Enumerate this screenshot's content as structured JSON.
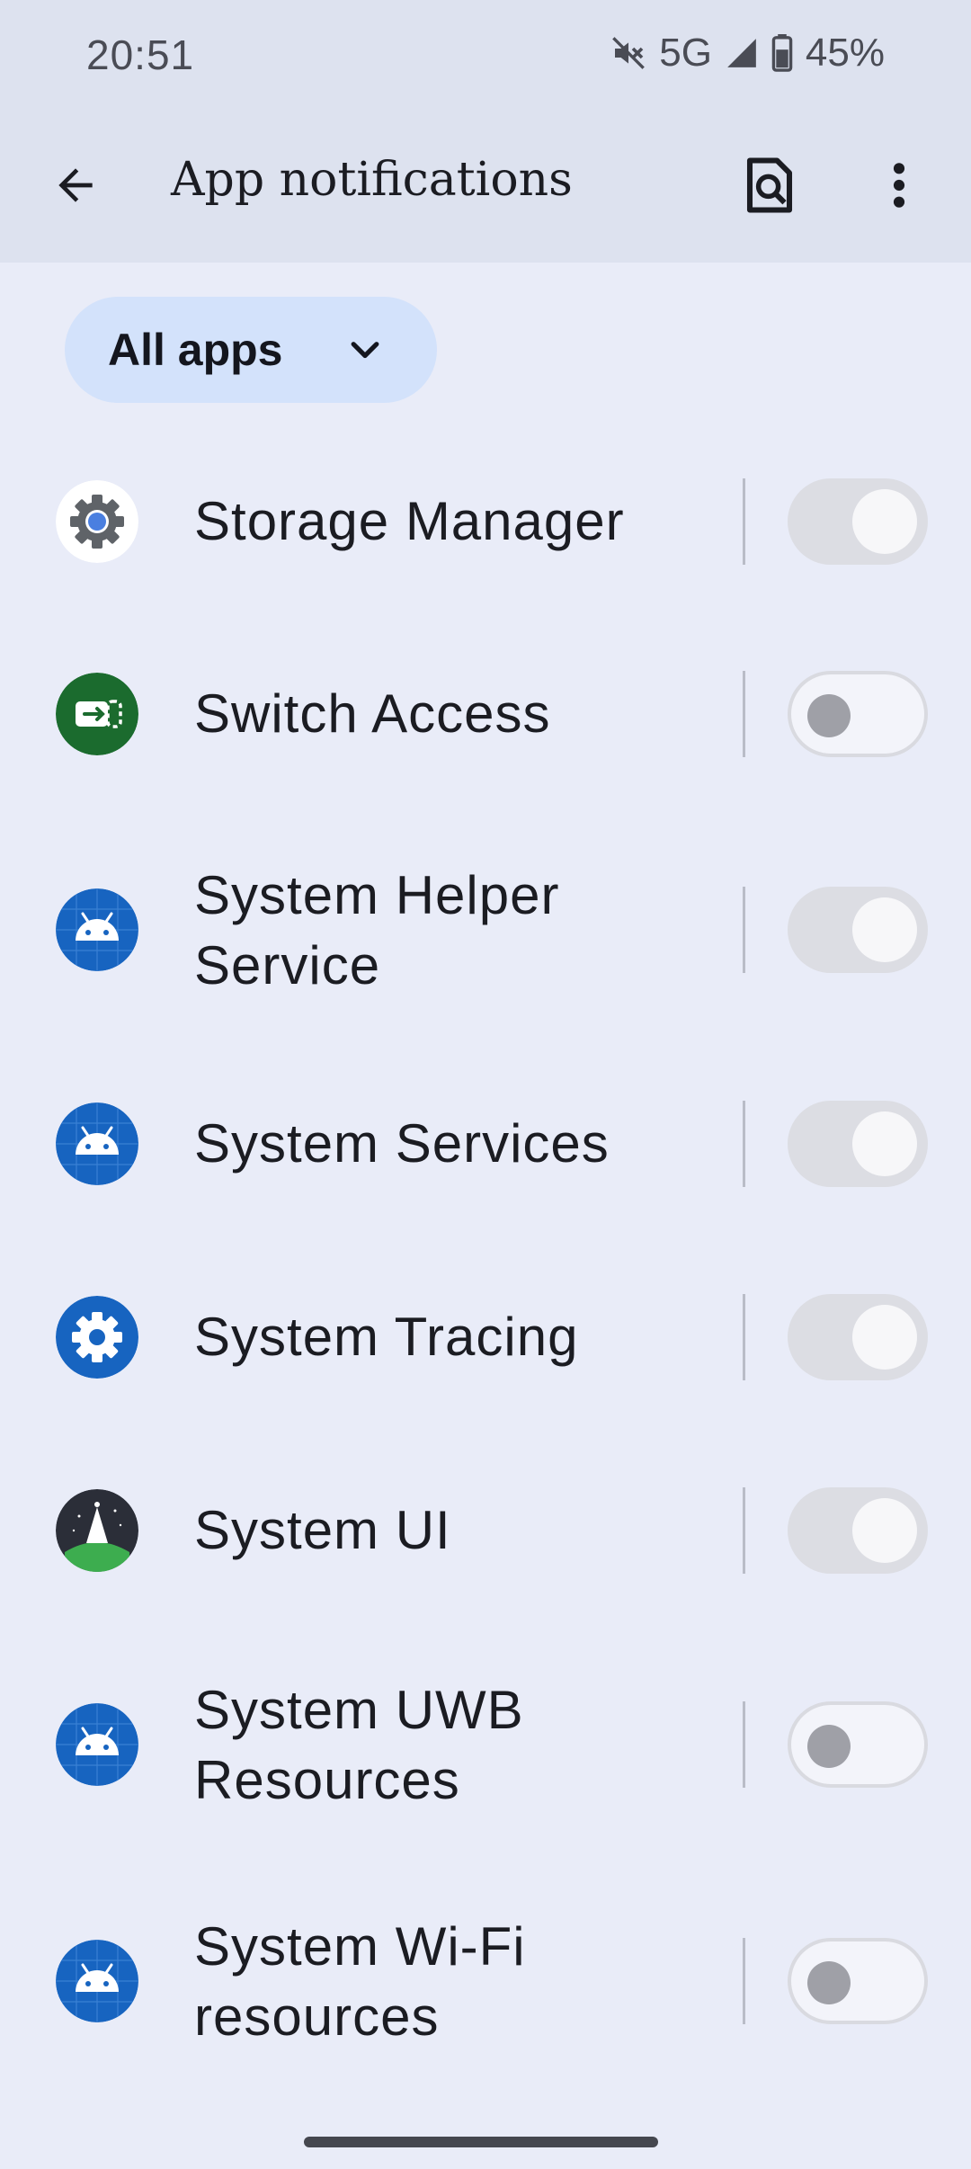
{
  "status_bar": {
    "time": "20:51",
    "network": "5G",
    "battery": "45%",
    "icons": [
      "mute-icon",
      "signal-icon",
      "battery-icon"
    ]
  },
  "app_bar": {
    "title": "App notifications",
    "back_icon": "back-arrow-icon",
    "search_icon": "search-settings-icon",
    "more_icon": "more-vert-icon"
  },
  "filter": {
    "selected": "All apps"
  },
  "apps": [
    {
      "name": "Storage Manager",
      "icon": "storage-manager-icon",
      "notifications": "on-disabled"
    },
    {
      "name": "Switch Access",
      "icon": "switch-access-icon",
      "notifications": "off"
    },
    {
      "name": "System Helper Service",
      "icon": "android-icon",
      "notifications": "on-disabled"
    },
    {
      "name": "System Services",
      "icon": "android-icon",
      "notifications": "on-disabled"
    },
    {
      "name": "System Tracing",
      "icon": "system-tracing-icon",
      "notifications": "on-disabled"
    },
    {
      "name": "System UI",
      "icon": "system-ui-icon",
      "notifications": "on-disabled"
    },
    {
      "name": "System UWB Resources",
      "icon": "android-icon",
      "notifications": "off"
    },
    {
      "name": "System Wi-Fi resources",
      "icon": "android-icon",
      "notifications": "off"
    }
  ],
  "colors": {
    "background": "#e9ecf8",
    "top_bar": "#dde2ef",
    "chip": "#d3e2fb",
    "android_icon_blue": "#1764c0",
    "switch_access_green": "#1b6b2e"
  }
}
